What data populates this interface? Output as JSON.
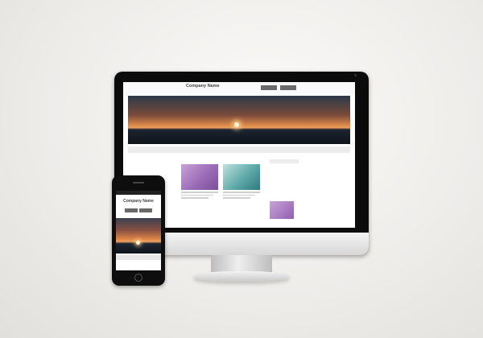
{
  "desktop": {
    "logo": "Company Name",
    "tagline": "",
    "header_buttons": [
      "",
      ""
    ],
    "nav": [
      "",
      "",
      "",
      "",
      "",
      ""
    ],
    "section_title": "",
    "cards": [
      {
        "image": "purple-flower-photo",
        "lines": 3
      },
      {
        "image": "teal-water-photo",
        "lines": 3
      }
    ],
    "sidebar": {
      "title": "",
      "items": [
        "",
        "",
        "",
        "",
        ""
      ]
    },
    "lower_section_title": ""
  },
  "phone": {
    "status": "",
    "logo": "Company Name",
    "tagline": "",
    "buttons": [
      "",
      ""
    ]
  },
  "colors": {
    "background": "#efedea",
    "device": "#0b0b0c",
    "button": "#6a6a6a",
    "sunset": "#e08a4a"
  }
}
